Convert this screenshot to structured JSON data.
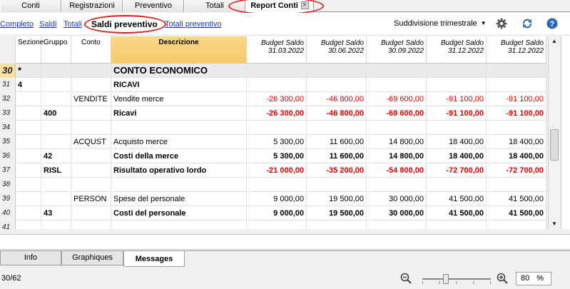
{
  "tabs": [
    {
      "label": "Conti"
    },
    {
      "label": "Registrazioni"
    },
    {
      "label": "Preventivo"
    },
    {
      "label": "Totali"
    },
    {
      "label": "Report Conti"
    }
  ],
  "views": [
    {
      "label": "Completo"
    },
    {
      "label": "Saldi"
    },
    {
      "label": "Totali"
    },
    {
      "label": "Saldi preventivo"
    },
    {
      "label": "Totali preventivo"
    }
  ],
  "subdivision": {
    "selected": "Suddivisione trimestrale"
  },
  "icons": {
    "settings": "gear-icon",
    "refresh": "refresh-icon",
    "help": "help-icon"
  },
  "columns": {
    "sezione": "Sezione",
    "gruppo": "Gruppo",
    "conto": "Conto",
    "descrizione": "Descrizione",
    "budget": [
      {
        "line1": "Budget Saldo",
        "line2": "31.03.2022"
      },
      {
        "line1": "Budget Saldo",
        "line2": "30.06.2022"
      },
      {
        "line1": "Budget Saldo",
        "line2": "30.09.2022"
      },
      {
        "line1": "Budget Saldo",
        "line2": "31.12.2022"
      },
      {
        "line1": "Budget Saldo",
        "line2": "31.12.2022"
      }
    ]
  },
  "rows": [
    {
      "n": "30",
      "sezione": "*",
      "gruppo": "",
      "conto": "",
      "desc": "CONTO ECONOMICO",
      "vals": [
        "",
        "",
        "",
        "",
        ""
      ],
      "bold": true,
      "section": true,
      "neg": false,
      "current": true
    },
    {
      "n": "31",
      "sezione": "4",
      "gruppo": "",
      "conto": "",
      "desc": "RICAVI",
      "vals": [
        "",
        "",
        "",
        "",
        ""
      ],
      "bold": true,
      "section": false,
      "neg": false,
      "current": false
    },
    {
      "n": "32",
      "sezione": "",
      "gruppo": "",
      "conto": "VENDITE",
      "desc": "Vendite merce",
      "vals": [
        "-26 300,00",
        "-46 800,00",
        "-69 600,00",
        "-91 100,00",
        "-91 100,00"
      ],
      "bold": false,
      "section": false,
      "neg": true,
      "current": false
    },
    {
      "n": "33",
      "sezione": "",
      "gruppo": "400",
      "conto": "",
      "desc": "Ricavi",
      "vals": [
        "-26 300,00",
        "-46 800,00",
        "-69 600,00",
        "-91 100,00",
        "-91 100,00"
      ],
      "bold": true,
      "section": false,
      "neg": true,
      "current": false
    },
    {
      "n": "34",
      "sezione": "",
      "gruppo": "",
      "conto": "",
      "desc": "",
      "vals": [
        "",
        "",
        "",
        "",
        ""
      ],
      "bold": false,
      "section": false,
      "neg": false,
      "current": false
    },
    {
      "n": "35",
      "sezione": "",
      "gruppo": "",
      "conto": "ACQUST",
      "desc": "Acquisto merce",
      "vals": [
        "5 300,00",
        "11 600,00",
        "14 800,00",
        "18 400,00",
        "18 400,00"
      ],
      "bold": false,
      "section": false,
      "neg": false,
      "current": false
    },
    {
      "n": "36",
      "sezione": "",
      "gruppo": "42",
      "conto": "",
      "desc": "Costi della merce",
      "vals": [
        "5 300,00",
        "11 600,00",
        "14 800,00",
        "18 400,00",
        "18 400,00"
      ],
      "bold": true,
      "section": false,
      "neg": false,
      "current": false
    },
    {
      "n": "37",
      "sezione": "",
      "gruppo": "RISL",
      "conto": "",
      "desc": "Risultato operativo lordo",
      "vals": [
        "-21 000,00",
        "-35 200,00",
        "-54 800,00",
        "-72 700,00",
        "-72 700,00"
      ],
      "bold": true,
      "section": false,
      "neg": true,
      "current": false
    },
    {
      "n": "38",
      "sezione": "",
      "gruppo": "",
      "conto": "",
      "desc": "",
      "vals": [
        "",
        "",
        "",
        "",
        ""
      ],
      "bold": false,
      "section": false,
      "neg": false,
      "current": false
    },
    {
      "n": "39",
      "sezione": "",
      "gruppo": "",
      "conto": "PERSON",
      "desc": "Spese del personale",
      "vals": [
        "9 000,00",
        "19 500,00",
        "30 000,00",
        "41 500,00",
        "41 500,00"
      ],
      "bold": false,
      "section": false,
      "neg": false,
      "current": false
    },
    {
      "n": "40",
      "sezione": "",
      "gruppo": "43",
      "conto": "",
      "desc": "Costi del personale",
      "vals": [
        "9 000,00",
        "19 500,00",
        "30 000,00",
        "41 500,00",
        "41 500,00"
      ],
      "bold": true,
      "section": false,
      "neg": false,
      "current": false
    },
    {
      "n": "41",
      "sezione": "",
      "gruppo": "",
      "conto": "",
      "desc": "",
      "vals": [
        "",
        "",
        "",
        "",
        ""
      ],
      "bold": false,
      "section": false,
      "neg": false,
      "current": false
    }
  ],
  "bottom_tabs": [
    {
      "label": "Info"
    },
    {
      "label": "Graphiques"
    },
    {
      "label": "Messages"
    }
  ],
  "status": {
    "row_count": "30/62",
    "zoom_value": "80",
    "zoom_unit": "%"
  },
  "colors": {
    "negative": "#e00000",
    "highlight_header": "#f5c86a",
    "link": "#1a3ea8",
    "annotation": "#e02020"
  }
}
